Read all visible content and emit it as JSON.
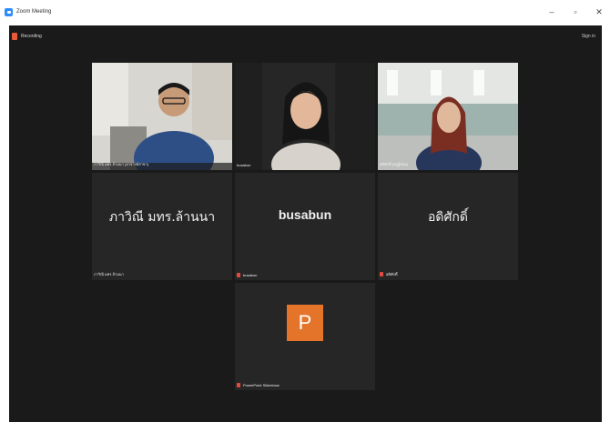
{
  "window": {
    "title": "Zoom Meeting",
    "controls": [
      "–",
      "▫",
      "✕"
    ]
  },
  "meeting": {
    "recording_label": "Recording",
    "signin_label": "Sign in",
    "accent": "#b8d14a",
    "record_color": "#e8593a",
    "participants": [
      {
        "display_name": "",
        "plate": "ภาวิณี มทร.ล้านนา (อาจารย์สาขา)",
        "video": true,
        "muted": false
      },
      {
        "display_name": "",
        "plate": "busabun",
        "video": true,
        "muted": false,
        "active": true
      },
      {
        "display_name": "",
        "plate": "อดิศักดิ์ (ครูผู้สอน)",
        "video": true,
        "muted": false
      },
      {
        "display_name": "ภาวิณี มทร.ล้านนา",
        "plate": "ภาวิณี มทร.ล้านนา",
        "video": false,
        "muted": false
      },
      {
        "display_name": "busabun",
        "plate": "busabun",
        "video": false,
        "muted": true
      },
      {
        "display_name": "อดิศักดิ์",
        "plate": "อดิศักดิ์",
        "video": false,
        "muted": true
      },
      {
        "display_name": "P",
        "plate": "PowerPoint Slideshow",
        "video": false,
        "muted": true,
        "avatar_letter": "P",
        "avatar_color": "#e3742a"
      }
    ]
  }
}
